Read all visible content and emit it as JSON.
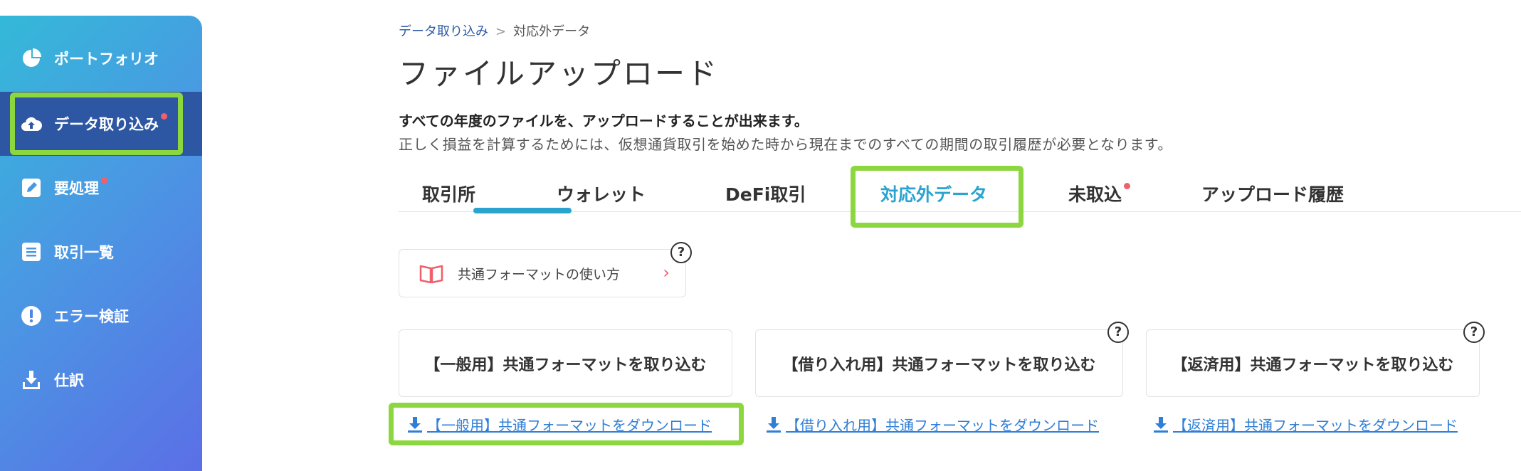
{
  "sidebar": {
    "items": [
      {
        "label": "ポートフォリオ",
        "icon": "pie-chart-icon"
      },
      {
        "label": "データ取り込み",
        "icon": "cloud-upload-icon",
        "badge": true
      },
      {
        "label": "要処理",
        "icon": "edit-icon",
        "badge": true
      },
      {
        "label": "取引一覧",
        "icon": "list-icon"
      },
      {
        "label": "エラー検証",
        "icon": "alert-icon"
      },
      {
        "label": "仕訳",
        "icon": "download-icon"
      }
    ]
  },
  "breadcrumb": {
    "parent": "データ取り込み",
    "separator": ">",
    "current": "対応外データ"
  },
  "page_title": "ファイルアップロード",
  "description": {
    "line1": "すべての年度のファイルを、アップロードすることが出来ます。",
    "line2": "正しく損益を計算するためには、仮想通貨取引を始めた時から現在までのすべての期間の取引履歴が必要となります。"
  },
  "tabs": [
    {
      "label": "取引所"
    },
    {
      "label": "ウォレット"
    },
    {
      "label": "DeFi取引"
    },
    {
      "label": "対応外データ",
      "active": true
    },
    {
      "label": "未取込",
      "badge": true
    },
    {
      "label": "アップロード履歴"
    }
  ],
  "guide_button": {
    "label": "共通フォーマットの使い方",
    "help": "?"
  },
  "import_cards": [
    {
      "label": "【一般用】共通フォーマットを取り込む",
      "help": "?"
    },
    {
      "label": "【借り入れ用】共通フォーマットを取り込む",
      "help": "?"
    },
    {
      "label": "【返済用】共通フォーマットを取り込む",
      "help": "?"
    }
  ],
  "download_links": [
    {
      "label": "【一般用】共通フォーマットをダウンロード"
    },
    {
      "label": "【借り入れ用】共通フォーマットをダウンロード"
    },
    {
      "label": "【返済用】共通フォーマットをダウンロード"
    }
  ],
  "colors": {
    "accent": "#2aa3cf",
    "highlight": "#8cd740",
    "badge": "#ef5f6c",
    "sidebar_active": "#2d57a3",
    "link": "#2f7fd6"
  }
}
